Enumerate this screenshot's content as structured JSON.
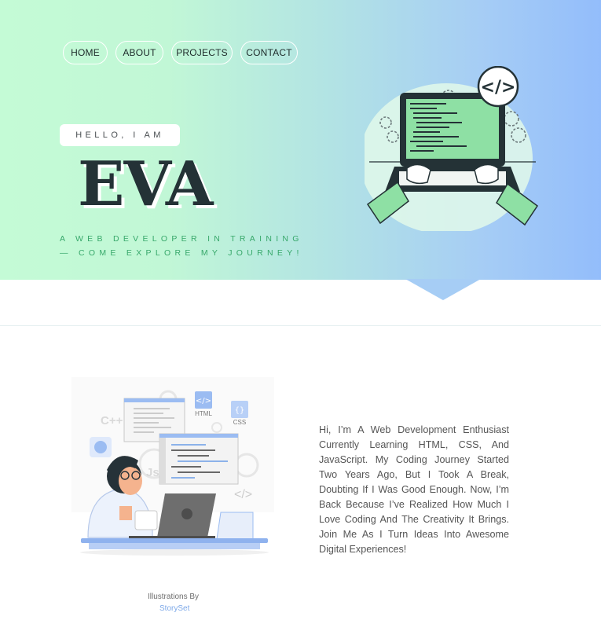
{
  "nav": {
    "items": [
      "HOME",
      "ABOUT",
      "PROJECTS",
      "CONTACT"
    ]
  },
  "hero": {
    "greeting": "HELLO, I AM",
    "name": "EVA",
    "tagline_line1": "A WEB DEVELOPER IN TRAINING",
    "tagline_line2": "— COME EXPLORE MY JOURNEY!"
  },
  "hero_illustration": {
    "icon": "code-tag-icon",
    "code_symbol": "</>"
  },
  "about_illustration": {
    "labels": {
      "cpp": "C++",
      "html": "HTML",
      "css": "CSS",
      "js": "Js",
      "html_badge": "</>",
      "css_badge": "{}",
      "code_tag": "</>"
    }
  },
  "about": {
    "bio": "Hi, I’m A Web Development Enthusiast Currently Learning HTML, CSS, And JavaScript. My Coding Journey Started Two Years Ago, But I Took A Break, Doubting If I Was Good Enough. Now, I’m Back Because I’ve Realized How Much I Love Coding And The Creativity It Brings. Join Me As I Turn Ideas Into Awesome Digital Experiences!"
  },
  "credit": {
    "text": "Illustrations By",
    "link": "StorySet"
  },
  "colors": {
    "hero_gradient_start": "#c4fbd6",
    "hero_gradient_end": "#93bdfb",
    "name_color": "#243236",
    "tagline_color": "#38a86b",
    "accent_green": "#8ee0a4",
    "accent_blue": "#7ea9e8"
  }
}
